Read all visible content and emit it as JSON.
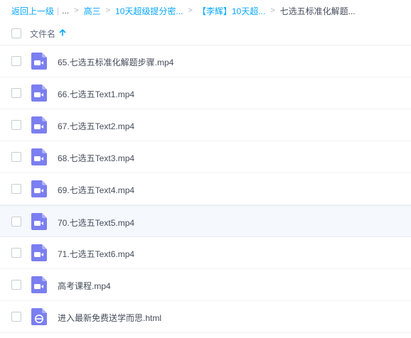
{
  "breadcrumb": {
    "back_label": "返回上一级",
    "ellipsis": "...",
    "separator": ">",
    "items": [
      "高三",
      "10天超级提分密...",
      "【李辉】10天超...",
      "七选五标准化解题..."
    ]
  },
  "header": {
    "name_column": "文件名"
  },
  "files": [
    {
      "name": "65.七选五标准化解题步骤.mp4",
      "icon": "video-file-icon"
    },
    {
      "name": "66.七选五Text1.mp4",
      "icon": "video-file-icon"
    },
    {
      "name": "67.七选五Text2.mp4",
      "icon": "video-file-icon"
    },
    {
      "name": "68.七选五Text3.mp4",
      "icon": "video-file-icon"
    },
    {
      "name": "69.七选五Text4.mp4",
      "icon": "video-file-icon"
    },
    {
      "name": "70.七选五Text5.mp4",
      "icon": "video-file-icon"
    },
    {
      "name": "71.七选五Text6.mp4",
      "icon": "video-file-icon"
    },
    {
      "name": "高考课程.mp4",
      "icon": "video-file-icon"
    },
    {
      "name": "进入最新免费送学而思.html",
      "icon": "web-file-icon"
    }
  ],
  "colors": {
    "accent": "#06a7ff",
    "file_icon": "#7b7ff0",
    "hover_row": "#f5f8fd"
  }
}
